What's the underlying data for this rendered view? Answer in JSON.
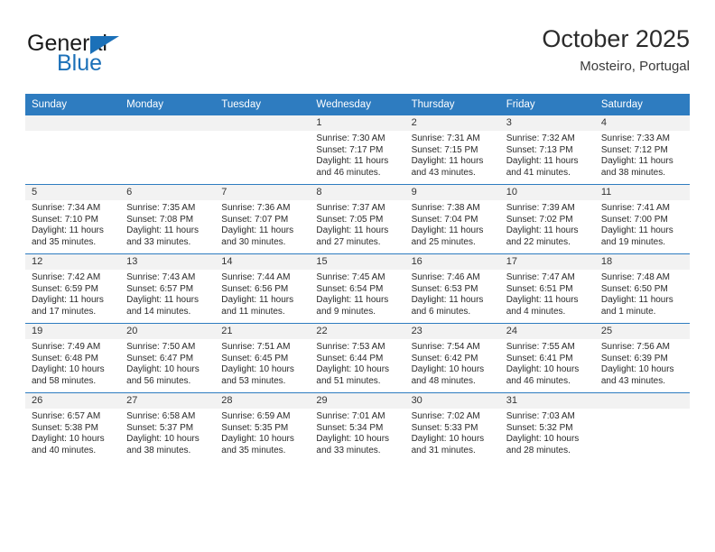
{
  "brand": {
    "name_part1": "General",
    "name_part2": "Blue"
  },
  "header": {
    "title": "October 2025",
    "subtitle": "Mosteiro, Portugal"
  },
  "colors": {
    "header_blue": "#2e7cc0",
    "brand_blue": "#1b70b8",
    "date_band": "#f2f2f2",
    "text": "#2a2a2a"
  },
  "weekday_headers": [
    "Sunday",
    "Monday",
    "Tuesday",
    "Wednesday",
    "Thursday",
    "Friday",
    "Saturday"
  ],
  "labels": {
    "sunrise_prefix": "Sunrise:",
    "sunset_prefix": "Sunset:",
    "daylight_prefix": "Daylight:"
  },
  "weeks": [
    [
      {
        "day": "",
        "empty": true,
        "sunrise": "",
        "sunset": "",
        "daylight_line1": "",
        "daylight_line2": ""
      },
      {
        "day": "",
        "empty": true,
        "sunrise": "",
        "sunset": "",
        "daylight_line1": "",
        "daylight_line2": ""
      },
      {
        "day": "",
        "empty": true,
        "sunrise": "",
        "sunset": "",
        "daylight_line1": "",
        "daylight_line2": ""
      },
      {
        "day": "1",
        "empty": false,
        "sunrise": "Sunrise: 7:30 AM",
        "sunset": "Sunset: 7:17 PM",
        "daylight_line1": "Daylight: 11 hours",
        "daylight_line2": "and 46 minutes."
      },
      {
        "day": "2",
        "empty": false,
        "sunrise": "Sunrise: 7:31 AM",
        "sunset": "Sunset: 7:15 PM",
        "daylight_line1": "Daylight: 11 hours",
        "daylight_line2": "and 43 minutes."
      },
      {
        "day": "3",
        "empty": false,
        "sunrise": "Sunrise: 7:32 AM",
        "sunset": "Sunset: 7:13 PM",
        "daylight_line1": "Daylight: 11 hours",
        "daylight_line2": "and 41 minutes."
      },
      {
        "day": "4",
        "empty": false,
        "sunrise": "Sunrise: 7:33 AM",
        "sunset": "Sunset: 7:12 PM",
        "daylight_line1": "Daylight: 11 hours",
        "daylight_line2": "and 38 minutes."
      }
    ],
    [
      {
        "day": "5",
        "empty": false,
        "sunrise": "Sunrise: 7:34 AM",
        "sunset": "Sunset: 7:10 PM",
        "daylight_line1": "Daylight: 11 hours",
        "daylight_line2": "and 35 minutes."
      },
      {
        "day": "6",
        "empty": false,
        "sunrise": "Sunrise: 7:35 AM",
        "sunset": "Sunset: 7:08 PM",
        "daylight_line1": "Daylight: 11 hours",
        "daylight_line2": "and 33 minutes."
      },
      {
        "day": "7",
        "empty": false,
        "sunrise": "Sunrise: 7:36 AM",
        "sunset": "Sunset: 7:07 PM",
        "daylight_line1": "Daylight: 11 hours",
        "daylight_line2": "and 30 minutes."
      },
      {
        "day": "8",
        "empty": false,
        "sunrise": "Sunrise: 7:37 AM",
        "sunset": "Sunset: 7:05 PM",
        "daylight_line1": "Daylight: 11 hours",
        "daylight_line2": "and 27 minutes."
      },
      {
        "day": "9",
        "empty": false,
        "sunrise": "Sunrise: 7:38 AM",
        "sunset": "Sunset: 7:04 PM",
        "daylight_line1": "Daylight: 11 hours",
        "daylight_line2": "and 25 minutes."
      },
      {
        "day": "10",
        "empty": false,
        "sunrise": "Sunrise: 7:39 AM",
        "sunset": "Sunset: 7:02 PM",
        "daylight_line1": "Daylight: 11 hours",
        "daylight_line2": "and 22 minutes."
      },
      {
        "day": "11",
        "empty": false,
        "sunrise": "Sunrise: 7:41 AM",
        "sunset": "Sunset: 7:00 PM",
        "daylight_line1": "Daylight: 11 hours",
        "daylight_line2": "and 19 minutes."
      }
    ],
    [
      {
        "day": "12",
        "empty": false,
        "sunrise": "Sunrise: 7:42 AM",
        "sunset": "Sunset: 6:59 PM",
        "daylight_line1": "Daylight: 11 hours",
        "daylight_line2": "and 17 minutes."
      },
      {
        "day": "13",
        "empty": false,
        "sunrise": "Sunrise: 7:43 AM",
        "sunset": "Sunset: 6:57 PM",
        "daylight_line1": "Daylight: 11 hours",
        "daylight_line2": "and 14 minutes."
      },
      {
        "day": "14",
        "empty": false,
        "sunrise": "Sunrise: 7:44 AM",
        "sunset": "Sunset: 6:56 PM",
        "daylight_line1": "Daylight: 11 hours",
        "daylight_line2": "and 11 minutes."
      },
      {
        "day": "15",
        "empty": false,
        "sunrise": "Sunrise: 7:45 AM",
        "sunset": "Sunset: 6:54 PM",
        "daylight_line1": "Daylight: 11 hours",
        "daylight_line2": "and 9 minutes."
      },
      {
        "day": "16",
        "empty": false,
        "sunrise": "Sunrise: 7:46 AM",
        "sunset": "Sunset: 6:53 PM",
        "daylight_line1": "Daylight: 11 hours",
        "daylight_line2": "and 6 minutes."
      },
      {
        "day": "17",
        "empty": false,
        "sunrise": "Sunrise: 7:47 AM",
        "sunset": "Sunset: 6:51 PM",
        "daylight_line1": "Daylight: 11 hours",
        "daylight_line2": "and 4 minutes."
      },
      {
        "day": "18",
        "empty": false,
        "sunrise": "Sunrise: 7:48 AM",
        "sunset": "Sunset: 6:50 PM",
        "daylight_line1": "Daylight: 11 hours",
        "daylight_line2": "and 1 minute."
      }
    ],
    [
      {
        "day": "19",
        "empty": false,
        "sunrise": "Sunrise: 7:49 AM",
        "sunset": "Sunset: 6:48 PM",
        "daylight_line1": "Daylight: 10 hours",
        "daylight_line2": "and 58 minutes."
      },
      {
        "day": "20",
        "empty": false,
        "sunrise": "Sunrise: 7:50 AM",
        "sunset": "Sunset: 6:47 PM",
        "daylight_line1": "Daylight: 10 hours",
        "daylight_line2": "and 56 minutes."
      },
      {
        "day": "21",
        "empty": false,
        "sunrise": "Sunrise: 7:51 AM",
        "sunset": "Sunset: 6:45 PM",
        "daylight_line1": "Daylight: 10 hours",
        "daylight_line2": "and 53 minutes."
      },
      {
        "day": "22",
        "empty": false,
        "sunrise": "Sunrise: 7:53 AM",
        "sunset": "Sunset: 6:44 PM",
        "daylight_line1": "Daylight: 10 hours",
        "daylight_line2": "and 51 minutes."
      },
      {
        "day": "23",
        "empty": false,
        "sunrise": "Sunrise: 7:54 AM",
        "sunset": "Sunset: 6:42 PM",
        "daylight_line1": "Daylight: 10 hours",
        "daylight_line2": "and 48 minutes."
      },
      {
        "day": "24",
        "empty": false,
        "sunrise": "Sunrise: 7:55 AM",
        "sunset": "Sunset: 6:41 PM",
        "daylight_line1": "Daylight: 10 hours",
        "daylight_line2": "and 46 minutes."
      },
      {
        "day": "25",
        "empty": false,
        "sunrise": "Sunrise: 7:56 AM",
        "sunset": "Sunset: 6:39 PM",
        "daylight_line1": "Daylight: 10 hours",
        "daylight_line2": "and 43 minutes."
      }
    ],
    [
      {
        "day": "26",
        "empty": false,
        "sunrise": "Sunrise: 6:57 AM",
        "sunset": "Sunset: 5:38 PM",
        "daylight_line1": "Daylight: 10 hours",
        "daylight_line2": "and 40 minutes."
      },
      {
        "day": "27",
        "empty": false,
        "sunrise": "Sunrise: 6:58 AM",
        "sunset": "Sunset: 5:37 PM",
        "daylight_line1": "Daylight: 10 hours",
        "daylight_line2": "and 38 minutes."
      },
      {
        "day": "28",
        "empty": false,
        "sunrise": "Sunrise: 6:59 AM",
        "sunset": "Sunset: 5:35 PM",
        "daylight_line1": "Daylight: 10 hours",
        "daylight_line2": "and 35 minutes."
      },
      {
        "day": "29",
        "empty": false,
        "sunrise": "Sunrise: 7:01 AM",
        "sunset": "Sunset: 5:34 PM",
        "daylight_line1": "Daylight: 10 hours",
        "daylight_line2": "and 33 minutes."
      },
      {
        "day": "30",
        "empty": false,
        "sunrise": "Sunrise: 7:02 AM",
        "sunset": "Sunset: 5:33 PM",
        "daylight_line1": "Daylight: 10 hours",
        "daylight_line2": "and 31 minutes."
      },
      {
        "day": "31",
        "empty": false,
        "sunrise": "Sunrise: 7:03 AM",
        "sunset": "Sunset: 5:32 PM",
        "daylight_line1": "Daylight: 10 hours",
        "daylight_line2": "and 28 minutes."
      },
      {
        "day": "",
        "empty": true,
        "sunrise": "",
        "sunset": "",
        "daylight_line1": "",
        "daylight_line2": ""
      }
    ]
  ]
}
